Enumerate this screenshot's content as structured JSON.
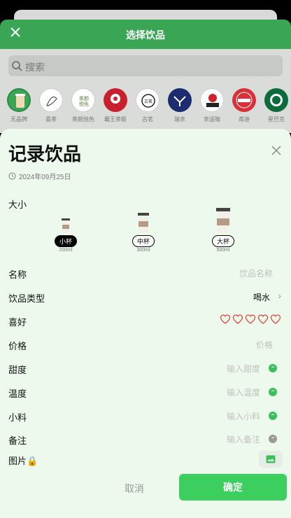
{
  "header": {
    "title": "选择饮品"
  },
  "search": {
    "placeholder": "搜索"
  },
  "brands": [
    {
      "name": "无品牌",
      "color": "#3aa655"
    },
    {
      "name": "喜茶",
      "color": "#ffffff"
    },
    {
      "name": "茶颜悦色",
      "color": "#ffffff"
    },
    {
      "name": "霸王茶姬",
      "color": "#c8202c"
    },
    {
      "name": "古茗",
      "color": "#ffffff"
    },
    {
      "name": "瑞幸",
      "color": "#1b2c6f"
    },
    {
      "name": "幸运咖",
      "color": "#ffffff"
    },
    {
      "name": "库迪",
      "color": "#d9303a"
    },
    {
      "name": "星巴克",
      "color": "#0b6b3a"
    }
  ],
  "sheet": {
    "title": "记录饮品",
    "date": "2024年09月25日",
    "size_label": "大小",
    "sizes": [
      {
        "name": "小杯",
        "ml": "200ml",
        "selected": true
      },
      {
        "name": "中杯",
        "ml": "300ml",
        "selected": false
      },
      {
        "name": "大杯",
        "ml": "500ml",
        "selected": false
      }
    ],
    "fields": {
      "name": {
        "label": "名称",
        "placeholder": "饮品名称"
      },
      "type": {
        "label": "饮品类型",
        "value": "喝水"
      },
      "rating": {
        "label": "喜好",
        "stars": 0,
        "max": 5
      },
      "price": {
        "label": "价格",
        "placeholder": "价格"
      },
      "sweetness": {
        "label": "甜度",
        "placeholder": "输入甜度"
      },
      "temperature": {
        "label": "温度",
        "placeholder": "输入温度"
      },
      "toppings": {
        "label": "小料",
        "placeholder": "输入小料"
      },
      "note": {
        "label": "备注",
        "placeholder": "输入备注"
      },
      "image": {
        "label": "图片🔒"
      }
    },
    "cancel_label": "取消",
    "confirm_label": "确定"
  },
  "colors": {
    "accent": "#3ccf5f",
    "header": "#3aa655",
    "heart": "#e04b3c"
  }
}
